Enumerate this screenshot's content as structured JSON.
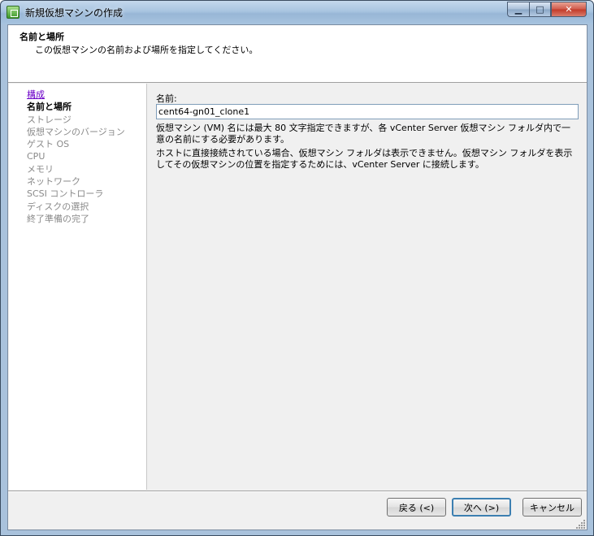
{
  "window": {
    "title": "新規仮想マシンの作成",
    "min_glyph": "▁",
    "max_glyph": "□",
    "close_glyph": "✕"
  },
  "header": {
    "title": "名前と場所",
    "subtitle": "この仮想マシンの名前および場所を指定してください。"
  },
  "steps": [
    {
      "label": "構成",
      "state": "done"
    },
    {
      "label": "名前と場所",
      "state": "current"
    },
    {
      "label": "ストレージ",
      "state": "pending"
    },
    {
      "label": "仮想マシンのバージョン",
      "state": "pending"
    },
    {
      "label": "ゲスト OS",
      "state": "pending"
    },
    {
      "label": "CPU",
      "state": "pending"
    },
    {
      "label": "メモリ",
      "state": "pending"
    },
    {
      "label": "ネットワーク",
      "state": "pending"
    },
    {
      "label": "SCSI コントローラ",
      "state": "pending"
    },
    {
      "label": "ディスクの選択",
      "state": "pending"
    },
    {
      "label": "終了準備の完了",
      "state": "pending"
    }
  ],
  "form": {
    "name_label": "名前:",
    "name_value": "cent64-gn01_clone1",
    "description1": "仮想マシン (VM) 名には最大 80 文字指定できますが、各 vCenter Server 仮想マシン フォルダ内で一意の名前にする必要があります。",
    "description2": "ホストに直接接続されている場合、仮想マシン フォルダは表示できません。仮想マシン フォルダを表示してその仮想マシンの位置を指定するためには、vCenter Server に接続します。"
  },
  "buttons": {
    "back": "戻る (<)",
    "next": "次へ (>)",
    "cancel": "キャンセル"
  },
  "colors": {
    "step_done": "#6b00c8",
    "step_pending": "#8a8a8a",
    "default_button_border": "#3c7fb1"
  }
}
